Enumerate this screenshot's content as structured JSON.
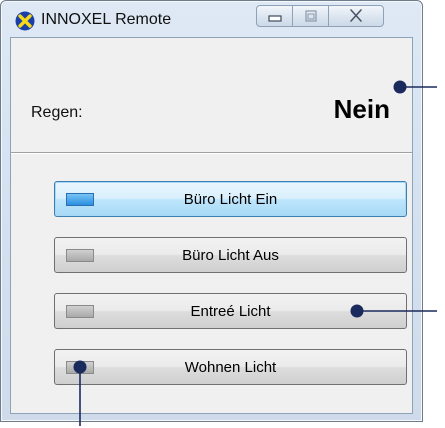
{
  "window": {
    "title": "INNOXEL Remote",
    "app_icon": "innoxel-x-icon",
    "caption_buttons": [
      "minimize-icon",
      "maximize-icon",
      "close-icon"
    ]
  },
  "status": {
    "rain_label": "Regen:",
    "rain_value": "Nein"
  },
  "buttons": [
    {
      "label": "Büro Licht Ein",
      "focused": true
    },
    {
      "label": "Büro Licht Aus",
      "focused": false
    },
    {
      "label": "Entreé Licht",
      "focused": false
    },
    {
      "label": "Wohnen Licht",
      "focused": false
    }
  ],
  "colors": {
    "callout": "#1b2a5c",
    "focus_blue": "#3c7fb1",
    "app_icon_blue": "#1a3fa8",
    "app_icon_yellow": "#f7d917"
  }
}
